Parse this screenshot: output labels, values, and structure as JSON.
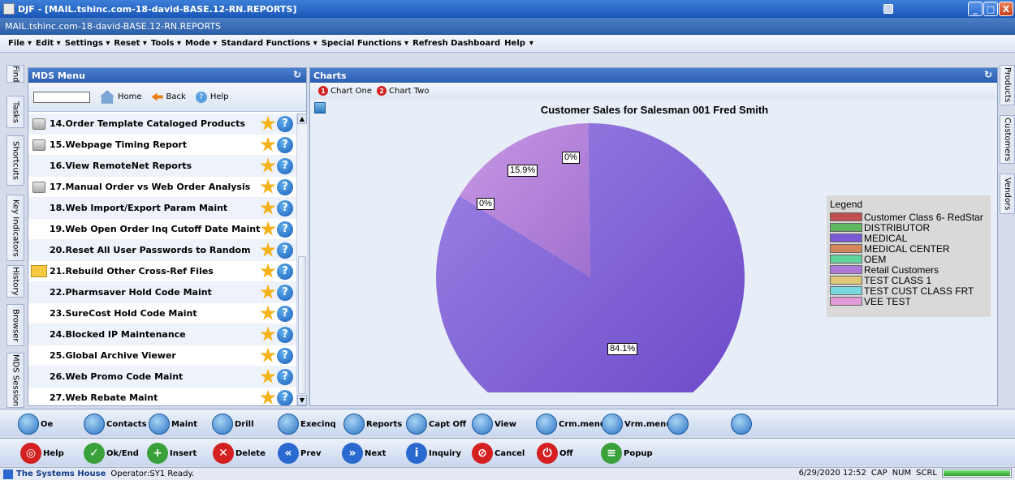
{
  "window": {
    "title": "DJF - [MAIL.tshinc.com-18-david-BASE.12-RN.REPORTS]",
    "subtitle": "MAIL.tshinc.com-18-david-BASE.12-RN.REPORTS",
    "minimize": "_",
    "maximize": "□",
    "close": "X"
  },
  "menubar": [
    "File ▾",
    "Edit ▾",
    "Settings ▾",
    "Reset ▾",
    "Tools ▾",
    "Mode ▾",
    "Standard Functions ▾",
    "Special Functions ▾",
    "Refresh Dashboard",
    "Help",
    "▾"
  ],
  "left_tabs": [
    "Find",
    "Tasks",
    "Shortcuts",
    "Key Indicators",
    "History",
    "Browser",
    "MDS Session"
  ],
  "right_tabs": [
    "Products",
    "Customers",
    "Vendors"
  ],
  "mds_panel": {
    "title": "MDS Menu",
    "refresh": "↻",
    "input_value": "",
    "home": "Home",
    "back": "Back",
    "help": "Help",
    "items": [
      {
        "label": "14.Order Template Cataloged Products",
        "icon": "printer"
      },
      {
        "label": "15.Webpage Timing Report",
        "icon": "printer"
      },
      {
        "label": "16.View RemoteNet Reports",
        "icon": ""
      },
      {
        "label": "17.Manual Order vs Web Order Analysis",
        "icon": "printer"
      },
      {
        "label": "18.Web Import/Export Param Maint",
        "icon": ""
      },
      {
        "label": "19.Web Open Order Inq Cutoff Date Maint",
        "icon": ""
      },
      {
        "label": "20.Reset All User Passwords to Random",
        "icon": ""
      },
      {
        "label": "21.Rebuild Other Cross-Ref Files",
        "icon": "folder"
      },
      {
        "label": "22.Pharmsaver Hold Code Maint",
        "icon": ""
      },
      {
        "label": "23.SureCost Hold Code Maint",
        "icon": ""
      },
      {
        "label": "24.Blocked IP Maintenance",
        "icon": ""
      },
      {
        "label": "25.Global Archive Viewer",
        "icon": ""
      },
      {
        "label": "26.Web Promo Code Maint",
        "icon": ""
      },
      {
        "label": "27.Web Rebate Maint",
        "icon": ""
      }
    ]
  },
  "charts_panel": {
    "title": "Charts",
    "refresh": "↻",
    "tabs": [
      {
        "num": "1",
        "label": "Chart One"
      },
      {
        "num": "2",
        "label": "Chart Two"
      }
    ]
  },
  "chart_data": {
    "type": "pie",
    "title": "Customer Sales for Salesman 001 Fred Smith",
    "legend_title": "Legend",
    "legend_placement": "right",
    "slices": [
      {
        "name": "Customer Class 6- RedStar",
        "value": 0,
        "color": "#c0504d",
        "label": ""
      },
      {
        "name": "DISTRIBUTOR",
        "value": 0,
        "color": "#5fb85f",
        "label": ""
      },
      {
        "name": "MEDICAL",
        "value": 84.1,
        "color": "#7b5bd4",
        "label": "84.1%"
      },
      {
        "name": "MEDICAL CENTER",
        "value": 0,
        "color": "#d4875a",
        "label": ""
      },
      {
        "name": "OEM",
        "value": 0,
        "color": "#5fd49a",
        "label": "0%"
      },
      {
        "name": "Retail Customers",
        "value": 15.9,
        "color": "#b07ad8",
        "label": "15.9%"
      },
      {
        "name": "TEST CLASS 1",
        "value": 0,
        "color": "#e0c87a",
        "label": ""
      },
      {
        "name": "TEST CUST CLASS FRT",
        "value": 0,
        "color": "#7ad8e0",
        "label": ""
      },
      {
        "name": "VEE TEST",
        "value": 0,
        "color": "#e09ad8",
        "label": "0%"
      }
    ]
  },
  "function_bar_1": [
    "Oe",
    "Contacts",
    "Maint",
    "Drill",
    "Execinq",
    "Reports",
    "Capt Off",
    "View",
    "Crm.menu",
    "Vrm.menu",
    "",
    ""
  ],
  "function_bar_2": [
    {
      "label": "Help",
      "icon": "lifebuoy",
      "color": "#d42020"
    },
    {
      "label": "Ok/End",
      "icon": "check",
      "color": "#3aa03a"
    },
    {
      "label": "Insert",
      "icon": "plus",
      "color": "#3aa03a"
    },
    {
      "label": "Delete",
      "icon": "x",
      "color": "#d42020"
    },
    {
      "label": "Prev",
      "icon": "rewind",
      "color": "#2a6ad0"
    },
    {
      "label": "Next",
      "icon": "forward",
      "color": "#2a6ad0"
    },
    {
      "label": "Inquiry",
      "icon": "info",
      "color": "#2a6ad0"
    },
    {
      "label": "Cancel",
      "icon": "cancel",
      "color": "#d42020"
    },
    {
      "label": "Off",
      "icon": "power",
      "color": "#d42020"
    },
    {
      "label": "Popup",
      "icon": "database",
      "color": "#3aa03a"
    }
  ],
  "statusbar": {
    "company": "The Systems House",
    "status": "Operator:SY1 Ready.",
    "datetime": "6/29/2020 12:52",
    "cap": "CAP",
    "num": "NUM",
    "scrl": "SCRL"
  }
}
